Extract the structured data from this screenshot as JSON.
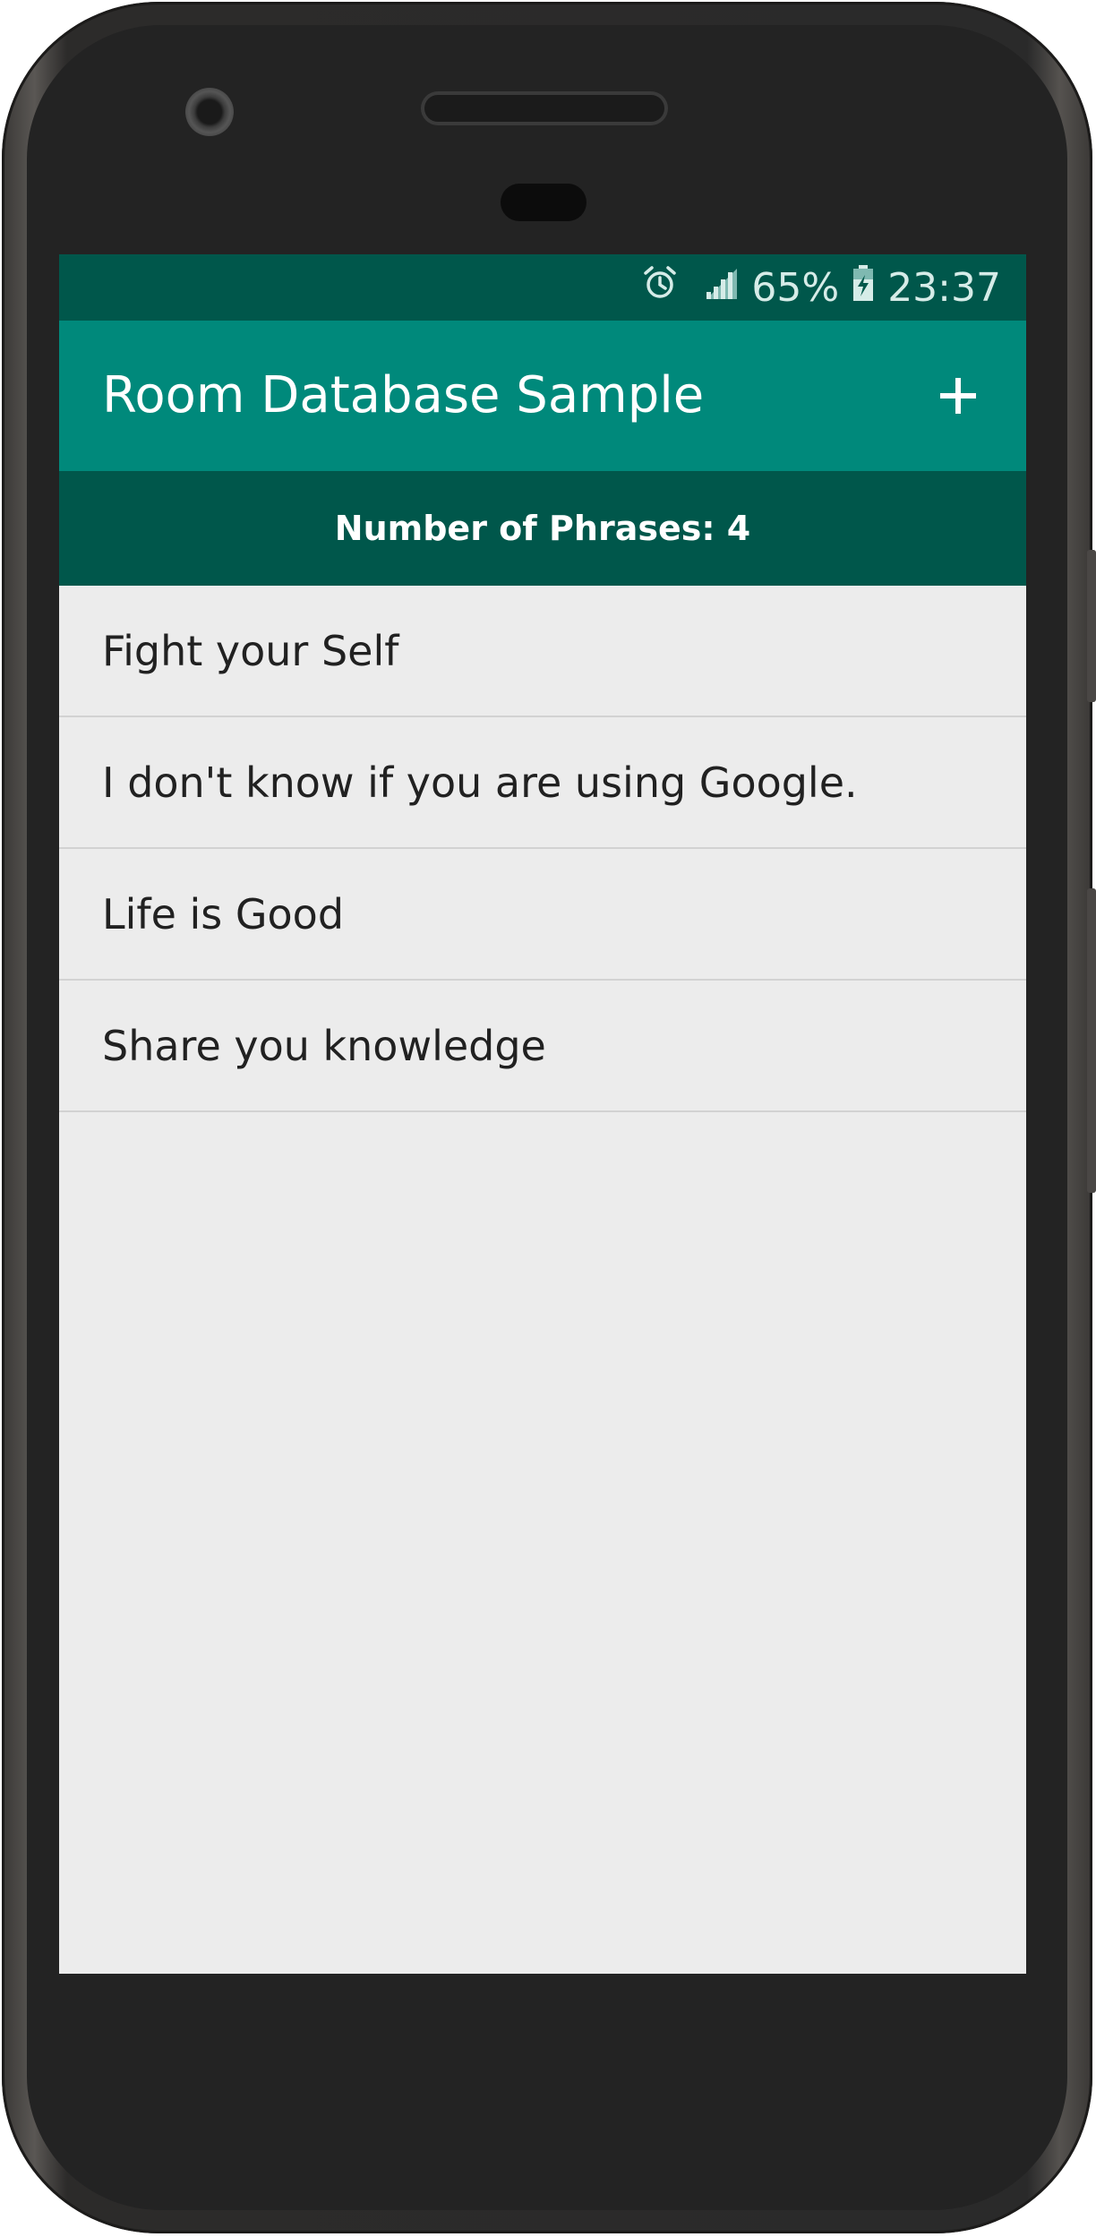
{
  "status_bar": {
    "alarm_icon": "alarm-clock-icon",
    "signal_icon": "cell-signal-icon",
    "battery_percent": "65%",
    "battery_icon": "battery-charging-icon",
    "time": "23:37"
  },
  "app_bar": {
    "title": "Room Database Sample",
    "add_icon": "plus-icon"
  },
  "phrase_count": {
    "label": "Number of Phrases: 4"
  },
  "phrases": [
    {
      "text": "Fight your Self"
    },
    {
      "text": "I don't know if you are using Google."
    },
    {
      "text": "Life is Good"
    },
    {
      "text": "Share you knowledge"
    }
  ],
  "colors": {
    "primary": "#00897b",
    "primary_dark": "#00574b",
    "background": "#ececec",
    "divider": "#d2d2d2",
    "text": "#212121"
  }
}
